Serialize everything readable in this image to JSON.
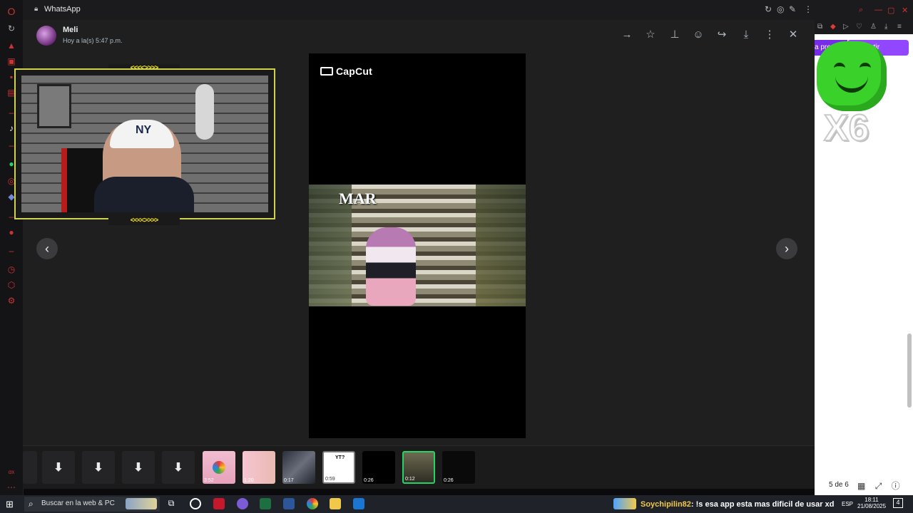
{
  "window": {
    "title": "WhatsApp"
  },
  "header": {
    "contact_name": "Meli",
    "contact_time": "Hoy a la(s) 5:47 p.m.",
    "actions": [
      "forward-icon",
      "star-icon",
      "pin-icon",
      "emoji-icon",
      "share-icon",
      "download-icon",
      "more-icon",
      "close-icon"
    ]
  },
  "media": {
    "brand": "CapCut",
    "caption": "MAR"
  },
  "thumbnails": [
    {
      "type": "video",
      "duration": "3:52"
    },
    {
      "type": "video",
      "duration": "1:20"
    },
    {
      "type": "video",
      "duration": "0:17"
    },
    {
      "type": "video",
      "duration": "0:59",
      "text": "YT?"
    },
    {
      "type": "video",
      "duration": "0:26"
    },
    {
      "type": "video",
      "duration": "0:12",
      "selected": true
    },
    {
      "type": "video",
      "duration": "0:26"
    }
  ],
  "right_panel": {
    "share_label": "mpartir",
    "left_label": "a pre",
    "overlay_text": "X6",
    "page_indicator": "5 de 6"
  },
  "webcam": {
    "cap_text": "NY",
    "chevrons": "<<<<>>>>"
  },
  "taskbar": {
    "search_placeholder": "Buscar en la web & PC",
    "chat_user": "Soychipilin82",
    "chat_text": ": !s esa app esta mas dificil de usar xd",
    "lang": "ESP",
    "time": "18:11",
    "date": "21/08/2025",
    "notif_count": "4"
  },
  "colors": {
    "viewer_bg": "#1f1f20",
    "twitch_purple": "#9147ff",
    "webcam_border": "#cfd24a",
    "selected_thumb": "#25d366"
  }
}
